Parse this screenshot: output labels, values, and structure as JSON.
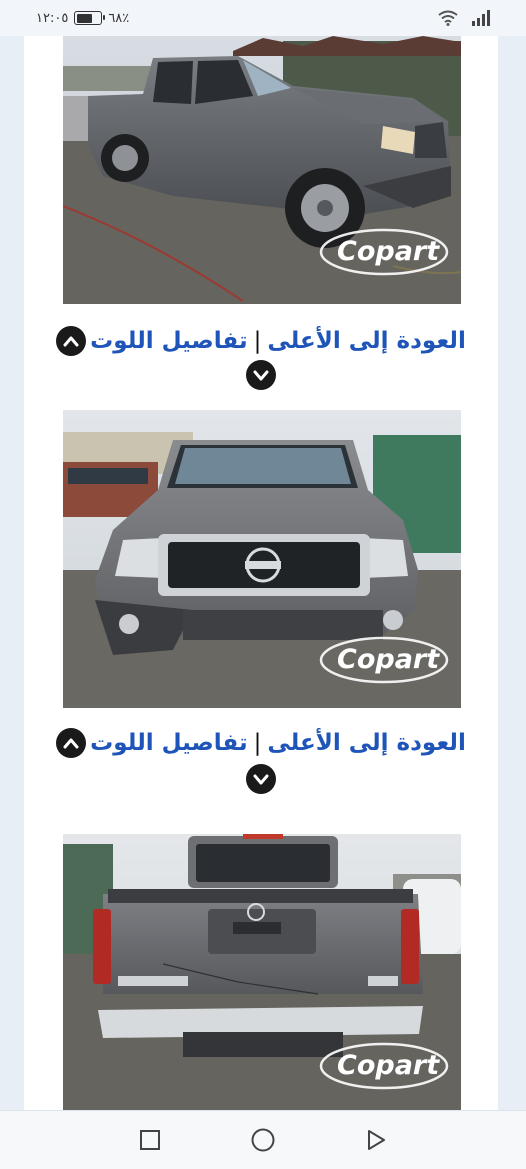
{
  "status_bar": {
    "time": "١٢:٠٥",
    "battery": "٦٨٪",
    "battery_level": 0.68
  },
  "photos": [
    {
      "watermark": "Copart"
    },
    {
      "watermark": "Copart"
    },
    {
      "watermark": "Copart"
    }
  ],
  "links": {
    "back_to_top": "العودة إلى الأعلى",
    "separator": "|",
    "lot_details": "تفاصيل اللوت"
  },
  "icons": {
    "up": "chevron-up-circle-icon",
    "down": "chevron-down-circle-icon"
  },
  "nav": [
    "square-recents-icon",
    "circle-home-icon",
    "triangle-back-icon"
  ]
}
